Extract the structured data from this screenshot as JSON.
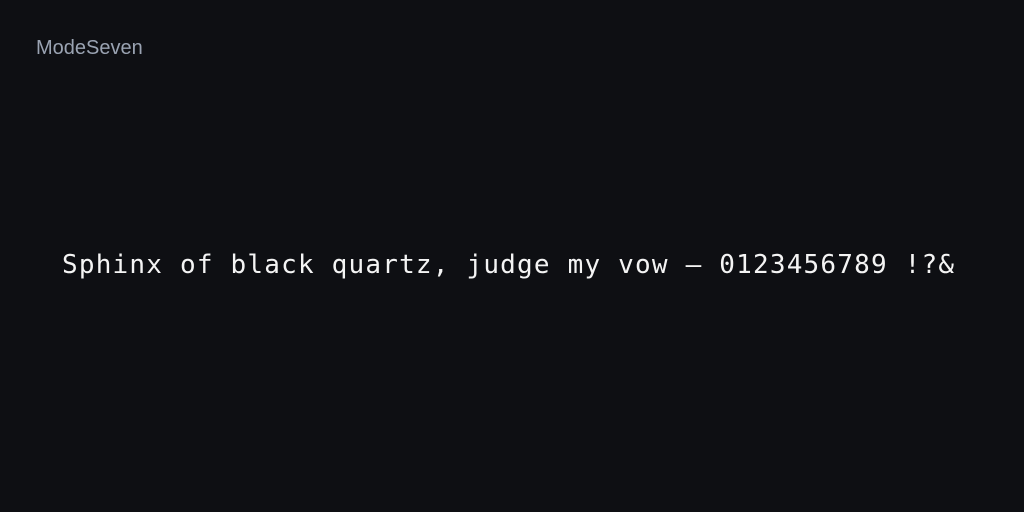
{
  "font_name": "ModeSeven",
  "sample_text": "Sphinx of black quartz, judge my vow — 0123456789 !?&",
  "colors": {
    "background": "#0e0f13",
    "label": "#9aa3b2",
    "sample": "#f4f4f4"
  }
}
